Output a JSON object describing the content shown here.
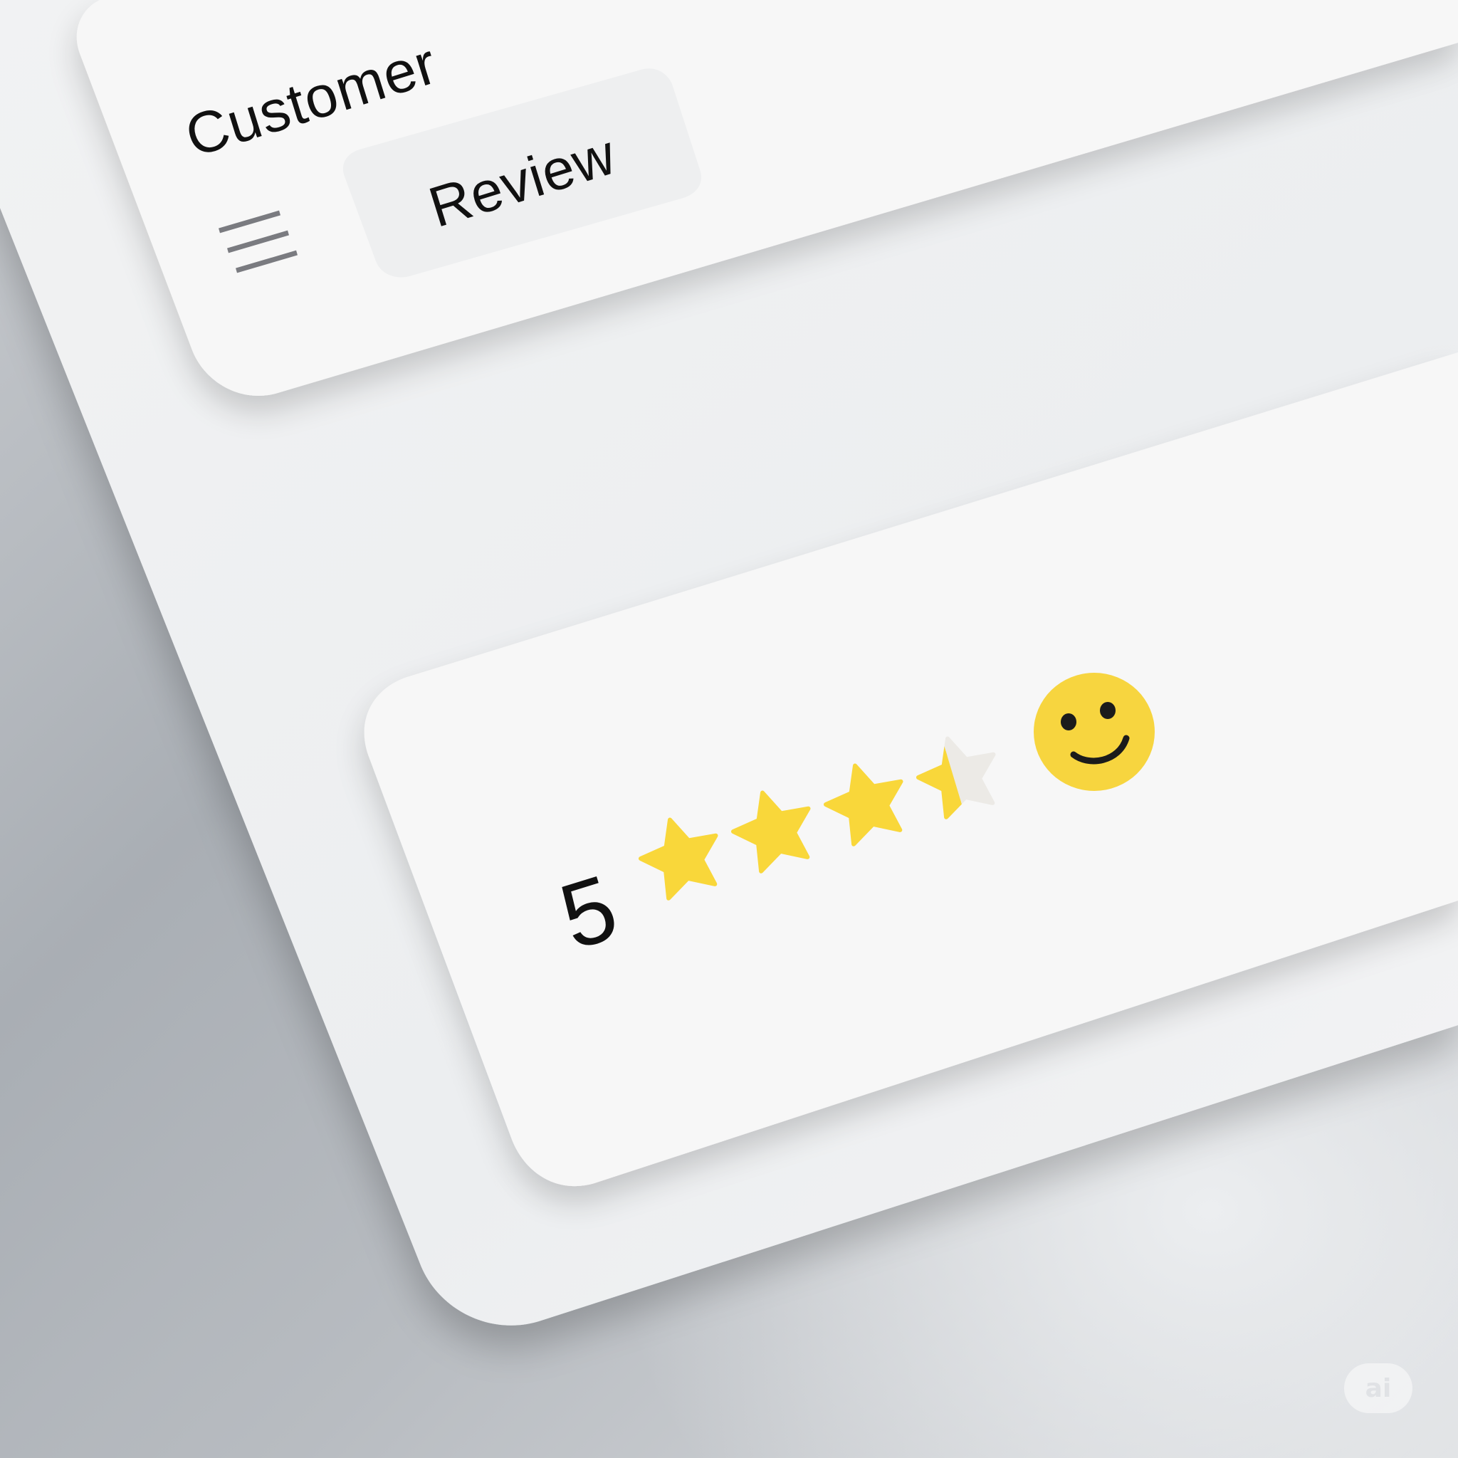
{
  "header": {
    "title": "Customer",
    "tab_label": "Review"
  },
  "rating": {
    "value_label": "5",
    "stars_filled": 3.5,
    "stars_total": 4
  },
  "icons": {
    "menu": "hamburger-menu-icon",
    "star": "star-icon",
    "face": "smiley-face-icon"
  },
  "badge": {
    "label": "ai"
  },
  "colors": {
    "panel": "#f7f7f7",
    "chip": "#eeeff0",
    "star_fill": "#f9d73a",
    "star_empty": "#eceae6",
    "smiley": "#f7d53f",
    "text": "#111111",
    "menu_lines": "#7a7b80"
  }
}
